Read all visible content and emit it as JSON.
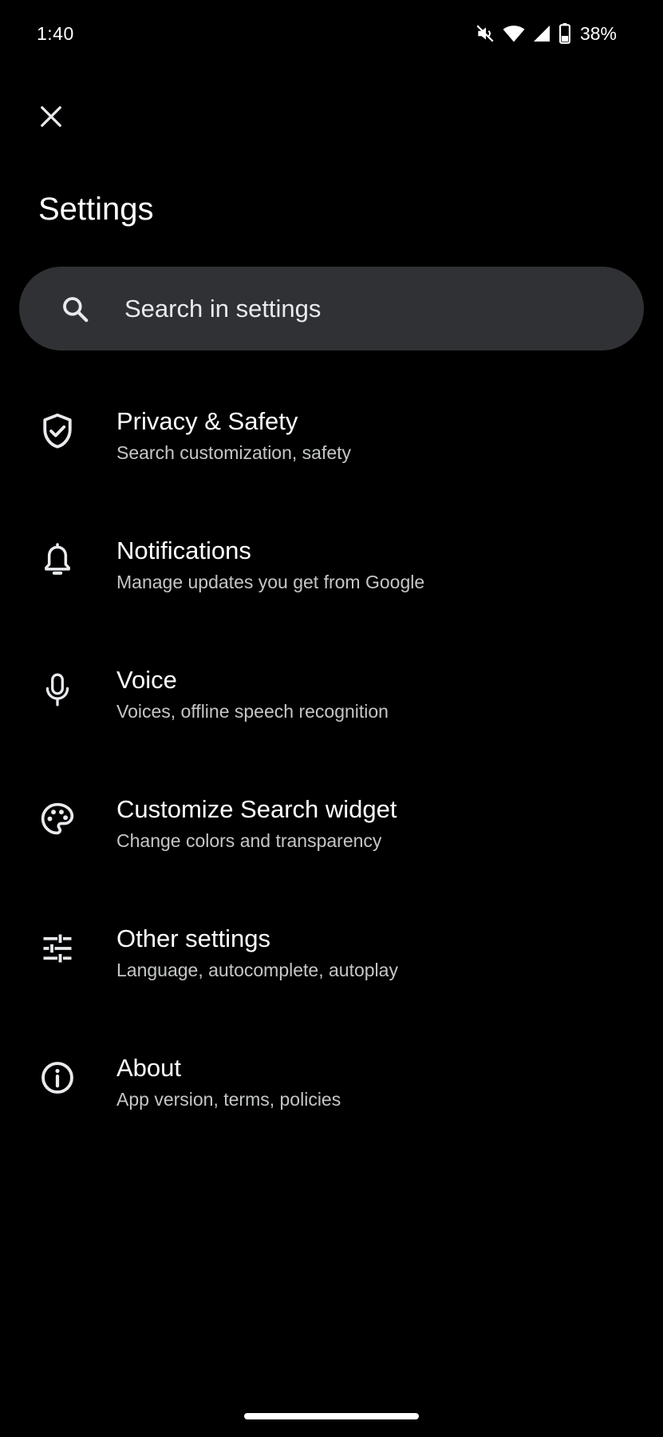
{
  "status_bar": {
    "time": "1:40",
    "battery_percent": "38%",
    "icons": [
      "mute-icon",
      "wifi-icon",
      "signal-icon",
      "battery-icon"
    ]
  },
  "header": {
    "close_icon": "close-icon",
    "title": "Settings"
  },
  "search": {
    "icon": "search-icon",
    "placeholder": "Search in settings"
  },
  "settings": {
    "items": [
      {
        "icon": "shield-check-icon",
        "title": "Privacy & Safety",
        "subtitle": "Search customization, safety"
      },
      {
        "icon": "bell-icon",
        "title": "Notifications",
        "subtitle": "Manage updates you get from Google"
      },
      {
        "icon": "microphone-icon",
        "title": "Voice",
        "subtitle": "Voices, offline speech recognition"
      },
      {
        "icon": "palette-icon",
        "title": "Customize Search widget",
        "subtitle": "Change colors and transparency"
      },
      {
        "icon": "tune-icon",
        "title": "Other settings",
        "subtitle": "Language, autocomplete, autoplay"
      },
      {
        "icon": "info-icon",
        "title": "About",
        "subtitle": "App version, terms, policies"
      }
    ]
  },
  "colors": {
    "background": "#000000",
    "search_bar": "#303134",
    "text_primary": "#ffffff",
    "text_secondary": "#c4c7c5"
  }
}
